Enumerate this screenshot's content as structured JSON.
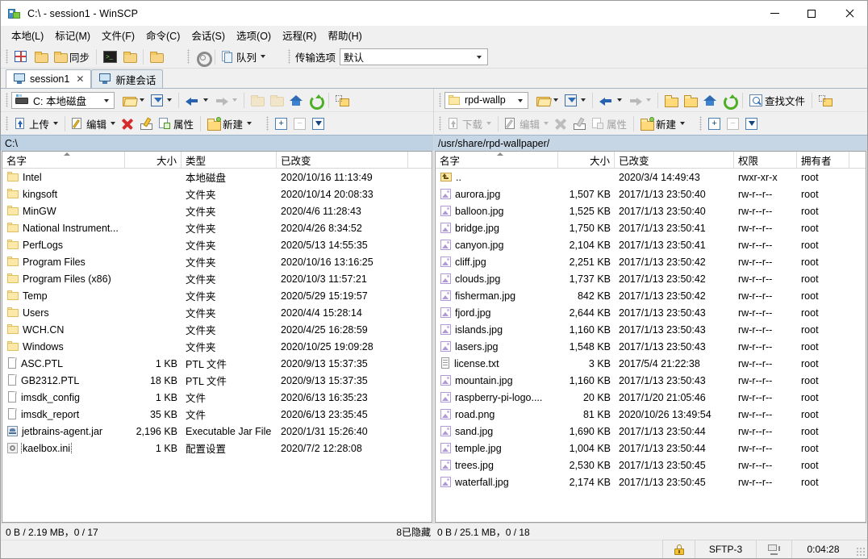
{
  "window": {
    "title": "C:\\ - session1 - WinSCP",
    "minimize_label": "—",
    "maximize_label": "□",
    "close_label": "✕"
  },
  "menu": [
    {
      "label": "本地(L)"
    },
    {
      "label": "标记(M)"
    },
    {
      "label": "文件(F)"
    },
    {
      "label": "命令(C)"
    },
    {
      "label": "会话(S)"
    },
    {
      "label": "选项(O)"
    },
    {
      "label": "远程(R)"
    },
    {
      "label": "帮助(H)"
    }
  ],
  "toolbar": {
    "sync_label": "同步",
    "queue_label": "队列",
    "transfer_options_label": "传输选项",
    "transfer_options_value": "默认",
    "icons": [
      "sync-icon",
      "sync-browse-icon",
      "sync-refresh-icon",
      "console-icon",
      "keepalive-icon",
      "compare-icon",
      "preferences-gear-icon",
      "queue-icon"
    ]
  },
  "tabs": [
    {
      "label": "session1",
      "active": true,
      "closable": true
    },
    {
      "label": "新建会话",
      "active": false,
      "closable": false
    }
  ],
  "left_pane": {
    "drive_label": "C: 本地磁盘",
    "path": "C:\\",
    "buttons": {
      "upload": "上传",
      "edit": "编辑",
      "properties": "属性",
      "new": "新建"
    },
    "columns": [
      {
        "key": "name",
        "label": "名字",
        "align": "left",
        "width": 152,
        "sorted": true
      },
      {
        "key": "size",
        "label": "大小",
        "align": "right",
        "width": 70
      },
      {
        "key": "type",
        "label": "类型",
        "align": "left",
        "width": 118
      },
      {
        "key": "modified",
        "label": "已改变",
        "align": "left",
        "width": 163
      }
    ],
    "rows": [
      {
        "icon": "folder-icon",
        "name": "Intel",
        "size": "",
        "type": "本地磁盘",
        "modified": "2020/10/16  11:13:49"
      },
      {
        "icon": "folder-icon",
        "name": "kingsoft",
        "size": "",
        "type": "文件夹",
        "modified": "2020/10/14  20:08:33"
      },
      {
        "icon": "folder-icon",
        "name": "MinGW",
        "size": "",
        "type": "文件夹",
        "modified": "2020/4/6  11:28:43"
      },
      {
        "icon": "folder-icon",
        "name": "National Instrument...",
        "size": "",
        "type": "文件夹",
        "modified": "2020/4/26  8:34:52"
      },
      {
        "icon": "folder-icon",
        "name": "PerfLogs",
        "size": "",
        "type": "文件夹",
        "modified": "2020/5/13  14:55:35"
      },
      {
        "icon": "folder-icon",
        "name": "Program Files",
        "size": "",
        "type": "文件夹",
        "modified": "2020/10/16  13:16:25"
      },
      {
        "icon": "folder-icon",
        "name": "Program Files (x86)",
        "size": "",
        "type": "文件夹",
        "modified": "2020/10/3  11:57:21"
      },
      {
        "icon": "folder-icon",
        "name": "Temp",
        "size": "",
        "type": "文件夹",
        "modified": "2020/5/29  15:19:57"
      },
      {
        "icon": "folder-icon",
        "name": "Users",
        "size": "",
        "type": "文件夹",
        "modified": "2020/4/4  15:28:14"
      },
      {
        "icon": "folder-icon",
        "name": "WCH.CN",
        "size": "",
        "type": "文件夹",
        "modified": "2020/4/25  16:28:59"
      },
      {
        "icon": "folder-icon",
        "name": "Windows",
        "size": "",
        "type": "文件夹",
        "modified": "2020/10/25  19:09:28"
      },
      {
        "icon": "file-icon",
        "name": "ASC.PTL",
        "size": "1 KB",
        "type": "PTL 文件",
        "modified": "2020/9/13  15:37:35"
      },
      {
        "icon": "file-icon",
        "name": "GB2312.PTL",
        "size": "18 KB",
        "type": "PTL 文件",
        "modified": "2020/9/13  15:37:35"
      },
      {
        "icon": "file-icon",
        "name": "imsdk_config",
        "size": "1 KB",
        "type": "文件",
        "modified": "2020/6/13  16:35:23"
      },
      {
        "icon": "file-icon",
        "name": "imsdk_report",
        "size": "35 KB",
        "type": "文件",
        "modified": "2020/6/13  23:35:45"
      },
      {
        "icon": "jar-icon",
        "name": "jetbrains-agent.jar",
        "size": "2,196 KB",
        "type": "Executable Jar File",
        "modified": "2020/1/31  15:26:40"
      },
      {
        "icon": "ini-icon",
        "name": "kaelbox.ini",
        "size": "1 KB",
        "type": "配置设置",
        "modified": "2020/7/2  12:28:08",
        "focused": true
      }
    ],
    "status": "0 B / 2.19 MB，0 / 17"
  },
  "right_pane": {
    "dir_label": "rpd-wallp",
    "path": "/usr/share/rpd-wallpaper/",
    "buttons": {
      "download": "下载",
      "edit": "编辑",
      "properties": "属性",
      "new": "新建",
      "find_files": "查找文件"
    },
    "columns": [
      {
        "key": "name",
        "label": "名字",
        "align": "left",
        "width": 152,
        "sorted": true
      },
      {
        "key": "size",
        "label": "大小",
        "align": "right",
        "width": 70
      },
      {
        "key": "modified",
        "label": "已改变",
        "align": "left",
        "width": 148
      },
      {
        "key": "rights",
        "label": "权限",
        "align": "left",
        "width": 78
      },
      {
        "key": "owner",
        "label": "拥有者",
        "align": "left",
        "width": 65
      }
    ],
    "rows": [
      {
        "icon": "parent-dir-icon",
        "name": "..",
        "size": "",
        "modified": "2020/3/4 14:49:43",
        "rights": "rwxr-xr-x",
        "owner": "root"
      },
      {
        "icon": "image-icon",
        "name": "aurora.jpg",
        "size": "1,507 KB",
        "modified": "2017/1/13 23:50:40",
        "rights": "rw-r--r--",
        "owner": "root"
      },
      {
        "icon": "image-icon",
        "name": "balloon.jpg",
        "size": "1,525 KB",
        "modified": "2017/1/13 23:50:40",
        "rights": "rw-r--r--",
        "owner": "root"
      },
      {
        "icon": "image-icon",
        "name": "bridge.jpg",
        "size": "1,750 KB",
        "modified": "2017/1/13 23:50:41",
        "rights": "rw-r--r--",
        "owner": "root"
      },
      {
        "icon": "image-icon",
        "name": "canyon.jpg",
        "size": "2,104 KB",
        "modified": "2017/1/13 23:50:41",
        "rights": "rw-r--r--",
        "owner": "root"
      },
      {
        "icon": "image-icon",
        "name": "cliff.jpg",
        "size": "2,251 KB",
        "modified": "2017/1/13 23:50:42",
        "rights": "rw-r--r--",
        "owner": "root"
      },
      {
        "icon": "image-icon",
        "name": "clouds.jpg",
        "size": "1,737 KB",
        "modified": "2017/1/13 23:50:42",
        "rights": "rw-r--r--",
        "owner": "root"
      },
      {
        "icon": "image-icon",
        "name": "fisherman.jpg",
        "size": "842 KB",
        "modified": "2017/1/13 23:50:42",
        "rights": "rw-r--r--",
        "owner": "root"
      },
      {
        "icon": "image-icon",
        "name": "fjord.jpg",
        "size": "2,644 KB",
        "modified": "2017/1/13 23:50:43",
        "rights": "rw-r--r--",
        "owner": "root"
      },
      {
        "icon": "image-icon",
        "name": "islands.jpg",
        "size": "1,160 KB",
        "modified": "2017/1/13 23:50:43",
        "rights": "rw-r--r--",
        "owner": "root"
      },
      {
        "icon": "image-icon",
        "name": "lasers.jpg",
        "size": "1,548 KB",
        "modified": "2017/1/13 23:50:43",
        "rights": "rw-r--r--",
        "owner": "root"
      },
      {
        "icon": "text-icon",
        "name": "license.txt",
        "size": "3 KB",
        "modified": "2017/5/4 21:22:38",
        "rights": "rw-r--r--",
        "owner": "root"
      },
      {
        "icon": "image-icon",
        "name": "mountain.jpg",
        "size": "1,160 KB",
        "modified": "2017/1/13 23:50:43",
        "rights": "rw-r--r--",
        "owner": "root"
      },
      {
        "icon": "image-icon",
        "name": "raspberry-pi-logo....",
        "size": "20 KB",
        "modified": "2017/1/20 21:05:46",
        "rights": "rw-r--r--",
        "owner": "root"
      },
      {
        "icon": "image-icon",
        "name": "road.png",
        "size": "81 KB",
        "modified": "2020/10/26 13:49:54",
        "rights": "rw-r--r--",
        "owner": "root"
      },
      {
        "icon": "image-icon",
        "name": "sand.jpg",
        "size": "1,690 KB",
        "modified": "2017/1/13 23:50:44",
        "rights": "rw-r--r--",
        "owner": "root"
      },
      {
        "icon": "image-icon",
        "name": "temple.jpg",
        "size": "1,004 KB",
        "modified": "2017/1/13 23:50:44",
        "rights": "rw-r--r--",
        "owner": "root"
      },
      {
        "icon": "image-icon",
        "name": "trees.jpg",
        "size": "2,530 KB",
        "modified": "2017/1/13 23:50:45",
        "rights": "rw-r--r--",
        "owner": "root"
      },
      {
        "icon": "image-icon",
        "name": "waterfall.jpg",
        "size": "2,174 KB",
        "modified": "2017/1/13 23:50:45",
        "rights": "rw-r--r--",
        "owner": "root"
      }
    ],
    "hidden_note": "8已隐藏",
    "status": "0 B / 25.1 MB，0 / 18"
  },
  "bottombar": {
    "protocol": "SFTP-3",
    "elapsed": "0:04:28"
  },
  "colors": {
    "path_bar": "#bed2e4",
    "title_bg": "#ffffff",
    "chrome": "#f0f0f0",
    "folder": "#fce9a8",
    "image_icon": "#b09ad6"
  }
}
